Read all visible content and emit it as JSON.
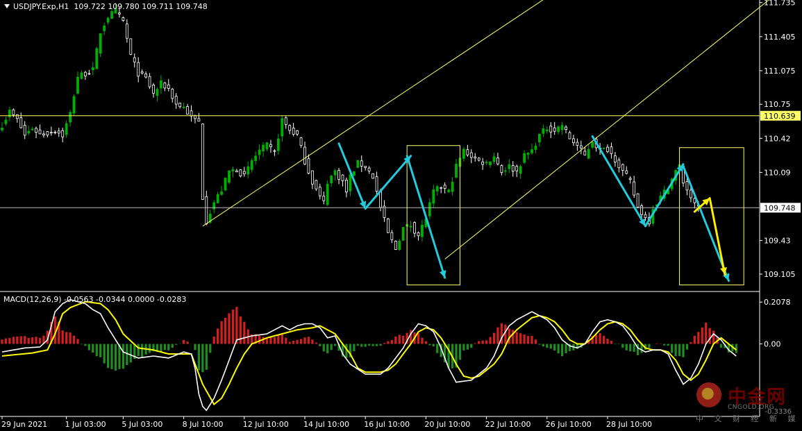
{
  "header": {
    "symbol_info": "USDJPY.Exp,H1  109.722 109.780 109.711 109.748",
    "macd_info": "MACD(12,26,9) -0.0563 -0.0344 0.0000 -0.0283"
  },
  "watermark": {
    "name": "中金网",
    "domain": "CNGOLD.ORG",
    "tagline": "中 文 财 经 新 媒 体",
    "corner_value": "-0.3336"
  },
  "colors": {
    "background": "#000000",
    "bull_candle": "#00b000",
    "bear_candle": "#ffffff",
    "trendline": "#ffff66",
    "level_line": "#ffff66",
    "current_line": "#bbbbbb",
    "arrow_cyan": "#22ccdd",
    "arrow_yellow": "#ffee00",
    "macd_main": "#ffffff",
    "macd_signal": "#ffff00",
    "hist_pos": "#d02020",
    "hist_neg": "#228b22"
  },
  "chart_data": [
    {
      "type": "candlestick",
      "symbol": "USDJPY.Exp",
      "timeframe": "H1",
      "ohlc_last": {
        "open": 109.722,
        "high": 109.78,
        "low": 109.711,
        "close": 109.748
      },
      "ylim": [
        108.95,
        111.76
      ],
      "y_ticks": [
        111.735,
        111.405,
        111.075,
        110.75,
        110.42,
        110.09,
        109.43,
        109.105
      ],
      "x_ticks": [
        "29 Jun 2021",
        "1 Jul 03:00",
        "5 Jul 03:00",
        "8 Jul 10:00",
        "12 Jul 10:00",
        "14 Jul 10:00",
        "16 Jul 10:00",
        "20 Jul 10:00",
        "22 Jul 10:00",
        "26 Jul 10:00",
        "28 Jul 10:00"
      ],
      "price_labels": {
        "level": "110.639",
        "current": "109.748"
      },
      "levels": {
        "horizontal_level": 110.639,
        "current_price": 109.748
      },
      "close_path": [
        [
          0,
          110.55
        ],
        [
          2,
          110.68
        ],
        [
          4,
          110.6
        ],
        [
          6,
          110.45
        ],
        [
          8,
          110.52
        ],
        [
          10,
          110.46
        ],
        [
          12,
          110.47
        ],
        [
          14,
          110.5
        ],
        [
          16,
          110.45
        ],
        [
          18,
          110.66
        ],
        [
          20,
          111.02
        ],
        [
          22,
          111.05
        ],
        [
          24,
          111.08
        ],
        [
          26,
          111.45
        ],
        [
          28,
          111.6
        ],
        [
          30,
          111.65
        ],
        [
          32,
          111.55
        ],
        [
          34,
          111.22
        ],
        [
          36,
          111.05
        ],
        [
          38,
          111.0
        ],
        [
          40,
          110.85
        ],
        [
          42,
          110.95
        ],
        [
          44,
          110.9
        ],
        [
          46,
          110.75
        ],
        [
          48,
          110.72
        ],
        [
          50,
          110.62
        ],
        [
          52,
          110.58
        ],
        [
          53,
          109.85
        ],
        [
          54,
          109.62
        ],
        [
          56,
          109.8
        ],
        [
          58,
          109.92
        ],
        [
          60,
          110.1
        ],
        [
          62,
          110.12
        ],
        [
          64,
          110.05
        ],
        [
          66,
          110.2
        ],
        [
          68,
          110.3
        ],
        [
          70,
          110.35
        ],
        [
          72,
          110.28
        ],
        [
          74,
          110.6
        ],
        [
          76,
          110.5
        ],
        [
          78,
          110.45
        ],
        [
          80,
          110.2
        ],
        [
          82,
          110.0
        ],
        [
          84,
          109.85
        ],
        [
          85,
          109.8
        ],
        [
          86,
          110.0
        ],
        [
          88,
          110.1
        ],
        [
          90,
          110.0
        ],
        [
          91,
          109.9
        ],
        [
          92,
          110.05
        ],
        [
          94,
          110.18
        ],
        [
          96,
          110.15
        ],
        [
          98,
          110.05
        ],
        [
          100,
          109.75
        ],
        [
          102,
          109.5
        ],
        [
          104,
          109.35
        ],
        [
          106,
          109.55
        ],
        [
          108,
          109.58
        ],
        [
          110,
          109.48
        ],
        [
          112,
          109.65
        ],
        [
          114,
          109.9
        ],
        [
          116,
          109.95
        ],
        [
          118,
          109.9
        ],
        [
          120,
          110.15
        ],
        [
          122,
          110.3
        ],
        [
          124,
          110.25
        ],
        [
          126,
          110.2
        ],
        [
          128,
          110.18
        ],
        [
          130,
          110.25
        ],
        [
          132,
          110.1
        ],
        [
          134,
          110.15
        ],
        [
          136,
          110.1
        ],
        [
          138,
          110.25
        ],
        [
          140,
          110.3
        ],
        [
          142,
          110.45
        ],
        [
          144,
          110.52
        ],
        [
          146,
          110.5
        ],
        [
          148,
          110.55
        ],
        [
          150,
          110.42
        ],
        [
          152,
          110.35
        ],
        [
          154,
          110.25
        ],
        [
          156,
          110.4
        ],
        [
          158,
          110.3
        ],
        [
          160,
          110.32
        ],
        [
          162,
          110.22
        ],
        [
          164,
          110.1
        ],
        [
          166,
          110.0
        ],
        [
          168,
          109.75
        ],
        [
          170,
          109.65
        ],
        [
          171,
          109.62
        ],
        [
          172,
          109.75
        ],
        [
          174,
          109.85
        ],
        [
          176,
          109.95
        ],
        [
          178,
          110.1
        ],
        [
          179,
          110.15
        ],
        [
          180,
          110.0
        ],
        [
          182,
          109.85
        ],
        [
          183,
          109.77
        ],
        [
          184,
          109.75
        ]
      ],
      "annotations": {
        "trendlines": [
          {
            "from": [
              53,
              109.57
            ],
            "to": [
              147,
              111.86
            ]
          },
          {
            "from": [
              117,
              109.25
            ],
            "to": [
              206,
              111.86
            ]
          }
        ],
        "boxes": [
          {
            "x": [
              107,
              121
            ],
            "y": [
              109.0,
              110.35
            ]
          },
          {
            "x": [
              179,
              196
            ],
            "y": [
              109.0,
              110.33
            ]
          }
        ],
        "cyan_arrows": [
          [
            [
              89,
              110.37
            ],
            [
              96,
              109.74
            ]
          ],
          [
            [
              96,
              109.74
            ],
            [
              108,
              110.25
            ]
          ],
          [
            [
              107,
              110.25
            ],
            [
              117,
              109.07
            ]
          ],
          [
            [
              156,
              110.44
            ],
            [
              170,
              109.57
            ]
          ],
          [
            [
              170,
              109.57
            ],
            [
              180,
              110.17
            ]
          ],
          [
            [
              180,
              110.15
            ],
            [
              192,
              109.04
            ]
          ]
        ],
        "yellow_arrows": [
          [
            [
              183,
              109.71
            ],
            [
              187,
              109.84
            ]
          ],
          [
            [
              187,
              109.84
            ],
            [
              191,
              109.1
            ]
          ]
        ]
      }
    },
    {
      "type": "macd",
      "params": "12,26,9",
      "values": {
        "main": -0.0563,
        "signal": -0.0344,
        "level": 0.0,
        "histogram": -0.0283
      },
      "ylim": [
        -0.36,
        0.25
      ],
      "y_ticks": [
        "0.2078",
        "0.00"
      ],
      "main_path": [
        [
          0,
          -0.04
        ],
        [
          6,
          -0.02
        ],
        [
          10,
          -0.015
        ],
        [
          12,
          0.02
        ],
        [
          14,
          0.16
        ],
        [
          16,
          0.2
        ],
        [
          18,
          0.22
        ],
        [
          20,
          0.21
        ],
        [
          22,
          0.2
        ],
        [
          24,
          0.17
        ],
        [
          26,
          0.15
        ],
        [
          28,
          0.08
        ],
        [
          30,
          0.02
        ],
        [
          32,
          -0.04
        ],
        [
          36,
          -0.07
        ],
        [
          40,
          -0.06
        ],
        [
          44,
          -0.07
        ],
        [
          48,
          -0.04
        ],
        [
          50,
          -0.05
        ],
        [
          51,
          -0.12
        ],
        [
          52,
          -0.25
        ],
        [
          53,
          -0.31
        ],
        [
          54,
          -0.33
        ],
        [
          56,
          -0.27
        ],
        [
          58,
          -0.18
        ],
        [
          60,
          -0.08
        ],
        [
          62,
          0.02
        ],
        [
          66,
          0.04
        ],
        [
          70,
          0.05
        ],
        [
          72,
          0.07
        ],
        [
          74,
          0.09
        ],
        [
          76,
          0.07
        ],
        [
          78,
          0.09
        ],
        [
          80,
          0.1
        ],
        [
          82,
          0.1
        ],
        [
          84,
          0.08
        ],
        [
          86,
          0.03
        ],
        [
          88,
          0.04
        ],
        [
          90,
          -0.05
        ],
        [
          92,
          -0.1
        ],
        [
          96,
          -0.15
        ],
        [
          100,
          -0.15
        ],
        [
          102,
          -0.12
        ],
        [
          104,
          -0.07
        ],
        [
          106,
          -0.02
        ],
        [
          108,
          0.05
        ],
        [
          110,
          0.1
        ],
        [
          112,
          0.09
        ],
        [
          114,
          0.06
        ],
        [
          116,
          -0.02
        ],
        [
          118,
          -0.12
        ],
        [
          120,
          -0.19
        ],
        [
          124,
          -0.18
        ],
        [
          128,
          -0.12
        ],
        [
          130,
          -0.06
        ],
        [
          132,
          0.03
        ],
        [
          134,
          0.09
        ],
        [
          136,
          0.12
        ],
        [
          138,
          0.14
        ],
        [
          140,
          0.16
        ],
        [
          142,
          0.14
        ],
        [
          144,
          0.12
        ],
        [
          146,
          0.08
        ],
        [
          148,
          0.02
        ],
        [
          150,
          -0.01
        ],
        [
          152,
          -0.02
        ],
        [
          154,
          0.0
        ],
        [
          156,
          0.06
        ],
        [
          158,
          0.11
        ],
        [
          160,
          0.12
        ],
        [
          162,
          0.11
        ],
        [
          164,
          0.09
        ],
        [
          166,
          0.04
        ],
        [
          168,
          -0.02
        ],
        [
          170,
          -0.04
        ],
        [
          172,
          -0.03
        ],
        [
          174,
          -0.03
        ],
        [
          176,
          -0.05
        ],
        [
          178,
          -0.13
        ],
        [
          180,
          -0.2
        ],
        [
          182,
          -0.17
        ],
        [
          184,
          -0.1
        ],
        [
          186,
          0.0
        ],
        [
          188,
          0.05
        ],
        [
          190,
          0.02
        ],
        [
          192,
          -0.03
        ],
        [
          194,
          -0.06
        ]
      ],
      "signal_path": [
        [
          0,
          -0.06
        ],
        [
          8,
          -0.045
        ],
        [
          12,
          -0.03
        ],
        [
          14,
          0.05
        ],
        [
          16,
          0.15
        ],
        [
          18,
          0.18
        ],
        [
          22,
          0.21
        ],
        [
          26,
          0.2
        ],
        [
          28,
          0.17
        ],
        [
          30,
          0.12
        ],
        [
          32,
          0.05
        ],
        [
          36,
          -0.02
        ],
        [
          40,
          -0.03
        ],
        [
          44,
          -0.05
        ],
        [
          48,
          -0.05
        ],
        [
          50,
          -0.05
        ],
        [
          53,
          -0.2
        ],
        [
          56,
          -0.3
        ],
        [
          58,
          -0.27
        ],
        [
          60,
          -0.2
        ],
        [
          62,
          -0.12
        ],
        [
          64,
          -0.05
        ],
        [
          66,
          0.0
        ],
        [
          70,
          0.03
        ],
        [
          74,
          0.05
        ],
        [
          78,
          0.07
        ],
        [
          82,
          0.08
        ],
        [
          84,
          0.09
        ],
        [
          86,
          0.07
        ],
        [
          88,
          0.05
        ],
        [
          90,
          0.0
        ],
        [
          92,
          -0.05
        ],
        [
          94,
          -0.12
        ],
        [
          96,
          -0.14
        ],
        [
          100,
          -0.14
        ],
        [
          102,
          -0.13
        ],
        [
          104,
          -0.1
        ],
        [
          106,
          -0.05
        ],
        [
          108,
          0.0
        ],
        [
          110,
          0.06
        ],
        [
          112,
          0.08
        ],
        [
          114,
          0.07
        ],
        [
          116,
          0.03
        ],
        [
          118,
          -0.03
        ],
        [
          120,
          -0.1
        ],
        [
          122,
          -0.16
        ],
        [
          124,
          -0.17
        ],
        [
          126,
          -0.16
        ],
        [
          128,
          -0.13
        ],
        [
          130,
          -0.1
        ],
        [
          132,
          -0.05
        ],
        [
          134,
          0.03
        ],
        [
          136,
          0.07
        ],
        [
          138,
          0.1
        ],
        [
          140,
          0.13
        ],
        [
          142,
          0.14
        ],
        [
          144,
          0.13
        ],
        [
          146,
          0.11
        ],
        [
          148,
          0.07
        ],
        [
          150,
          0.02
        ],
        [
          152,
          0.0
        ],
        [
          154,
          0.0
        ],
        [
          156,
          0.03
        ],
        [
          158,
          0.07
        ],
        [
          160,
          0.1
        ],
        [
          162,
          0.11
        ],
        [
          164,
          0.1
        ],
        [
          166,
          0.07
        ],
        [
          168,
          0.02
        ],
        [
          170,
          -0.02
        ],
        [
          172,
          -0.03
        ],
        [
          174,
          -0.03
        ],
        [
          176,
          -0.04
        ],
        [
          178,
          -0.08
        ],
        [
          180,
          -0.15
        ],
        [
          182,
          -0.18
        ],
        [
          184,
          -0.15
        ],
        [
          186,
          -0.08
        ],
        [
          188,
          0.0
        ],
        [
          190,
          0.03
        ],
        [
          192,
          0.0
        ],
        [
          194,
          -0.03
        ]
      ]
    }
  ]
}
